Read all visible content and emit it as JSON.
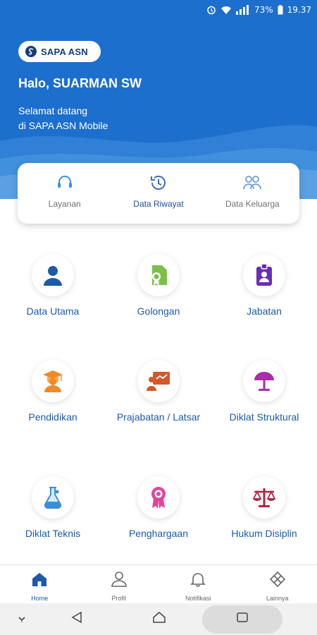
{
  "status_bar": {
    "battery": "73%",
    "time": "19.37",
    "icons": [
      "alarm-icon",
      "wifi-icon",
      "signal-icon",
      "battery-icon"
    ]
  },
  "header": {
    "logo_text": "SAPA ASN",
    "greeting": "Halo, SUARMAN SW",
    "welcome_line1": "Selamat datang",
    "welcome_line2": "di SAPA ASN Mobile",
    "bg_color": "#1d6fce"
  },
  "quick_menu": [
    {
      "label": "Layanan",
      "icon": "headset-icon"
    },
    {
      "label": "Data Riwayat",
      "icon": "history-icon"
    },
    {
      "label": "Data Keluarga",
      "icon": "family-icon"
    }
  ],
  "menu": [
    {
      "label": "Data Utama",
      "icon": "user-icon",
      "color": "#1d5aa8"
    },
    {
      "label": "Golongan",
      "icon": "certificate-icon",
      "color": "#7cc04a"
    },
    {
      "label": "Jabatan",
      "icon": "id-badge-icon",
      "color": "#6a2db8"
    },
    {
      "label": "Pendidikan",
      "icon": "graduate-icon",
      "color": "#f08a24"
    },
    {
      "label": "Prajabatan / Latsar",
      "icon": "presentation-icon",
      "color": "#d5572a"
    },
    {
      "label": "Diklat Struktural",
      "icon": "lamp-icon",
      "color": "#a92ca8"
    },
    {
      "label": "Diklat Teknis",
      "icon": "flask-icon",
      "color": "#3b8fd9"
    },
    {
      "label": "Penghargaan",
      "icon": "award-icon",
      "color": "#e0479a"
    },
    {
      "label": "Hukum Disiplin",
      "icon": "scale-icon",
      "color": "#b02540"
    }
  ],
  "bottom_nav": [
    {
      "label": "Home",
      "icon": "home-icon"
    },
    {
      "label": "Profil",
      "icon": "person-icon"
    },
    {
      "label": "Notifikasi",
      "icon": "bell-icon"
    },
    {
      "label": "Lainnya",
      "icon": "grid-diamond-icon"
    }
  ],
  "accent_color": "#1d5aa8"
}
